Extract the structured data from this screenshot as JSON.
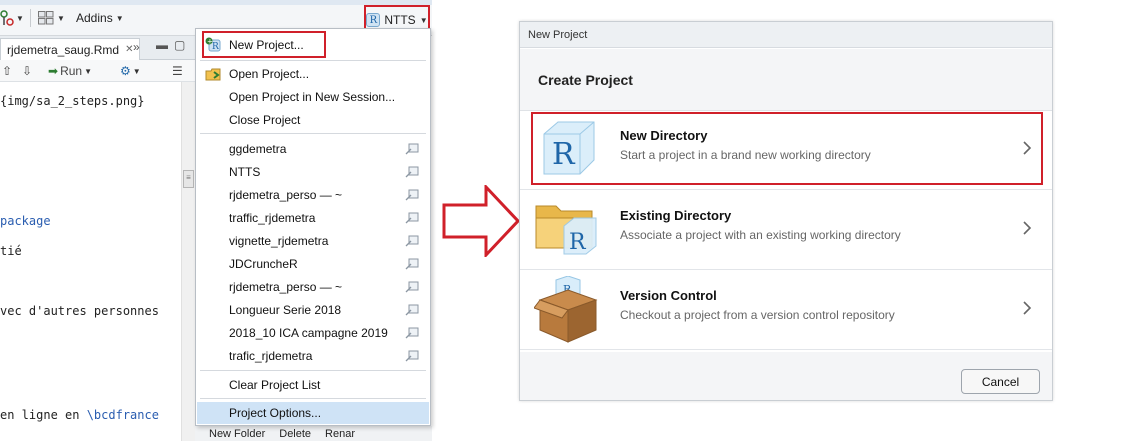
{
  "rstudio": {
    "toolbar": {
      "addins_label": "Addins",
      "project_label": "NTTS"
    },
    "editor": {
      "tab_label": "rjdemetra_saug.Rmd",
      "run_label": "Run",
      "code_lines": [
        "{img/sa_2_steps.png}",
        "package",
        "tié",
        "vec d'autres personnes",
        "en ligne en ",
        "\\bcdfrance"
      ]
    },
    "bottom_bar": {
      "new_folder": "New Folder",
      "delete": "Delete",
      "rename": "Renar"
    }
  },
  "project_menu": {
    "new_project": "New Project...",
    "open_project": "Open Project...",
    "open_new_session": "Open Project in New Session...",
    "close_project": "Close Project",
    "recent_projects": [
      "ggdemetra",
      "NTTS",
      "rjdemetra_perso — ~",
      "traffic_rjdemetra",
      "vignette_rjdemetra",
      "JDCruncheR",
      "rjdemetra_perso — ~",
      "Longueur Serie 2018",
      "2018_10 ICA campagne 2019",
      "trafic_rjdemetra"
    ],
    "clear_list": "Clear Project List",
    "project_options": "Project Options..."
  },
  "dialog": {
    "window_title": "New Project",
    "heading": "Create Project",
    "options": [
      {
        "title": "New Directory",
        "description": "Start a project in a brand new working directory",
        "icon": "r-cube-icon"
      },
      {
        "title": "Existing Directory",
        "description": "Associate a project with an existing working directory",
        "icon": "folder-r-icon"
      },
      {
        "title": "Version Control",
        "description": "Checkout a project from a version control repository",
        "icon": "cardboard-box-icon"
      }
    ],
    "cancel_label": "Cancel"
  },
  "colors": {
    "highlight_red": "#d0202a",
    "menu_selected": "#cfe3f6",
    "r_blue": "#1f66a8"
  }
}
